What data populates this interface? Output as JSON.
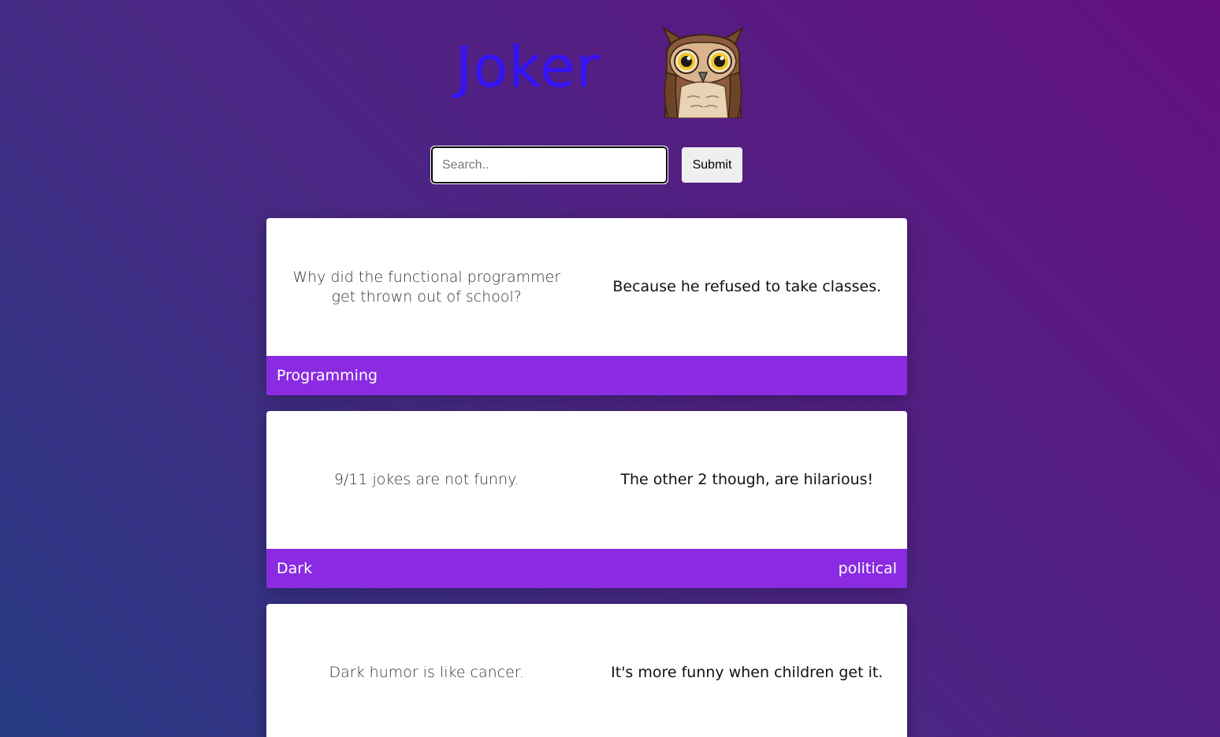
{
  "header": {
    "title": "Joker",
    "logo_icon": "owl-icon"
  },
  "search": {
    "placeholder": "Search..",
    "value": "",
    "submit_label": "Submit"
  },
  "jokes": [
    {
      "setup": "Why did the functional programmer get thrown out of school?",
      "punchline": "Because he refused to take classes.",
      "tags": [
        "Programming"
      ]
    },
    {
      "setup": "9/11 jokes are not funny.",
      "punchline": "The other 2 though, are hilarious!",
      "tags": [
        "Dark",
        "political"
      ]
    },
    {
      "setup": "Dark humor is like cancer.",
      "punchline": "It's more funny when children get it.",
      "tags": []
    }
  ],
  "colors": {
    "title": "#3413f5",
    "footer": "#8a2be2",
    "background_start": "#263a84",
    "background_end": "#64107f"
  }
}
